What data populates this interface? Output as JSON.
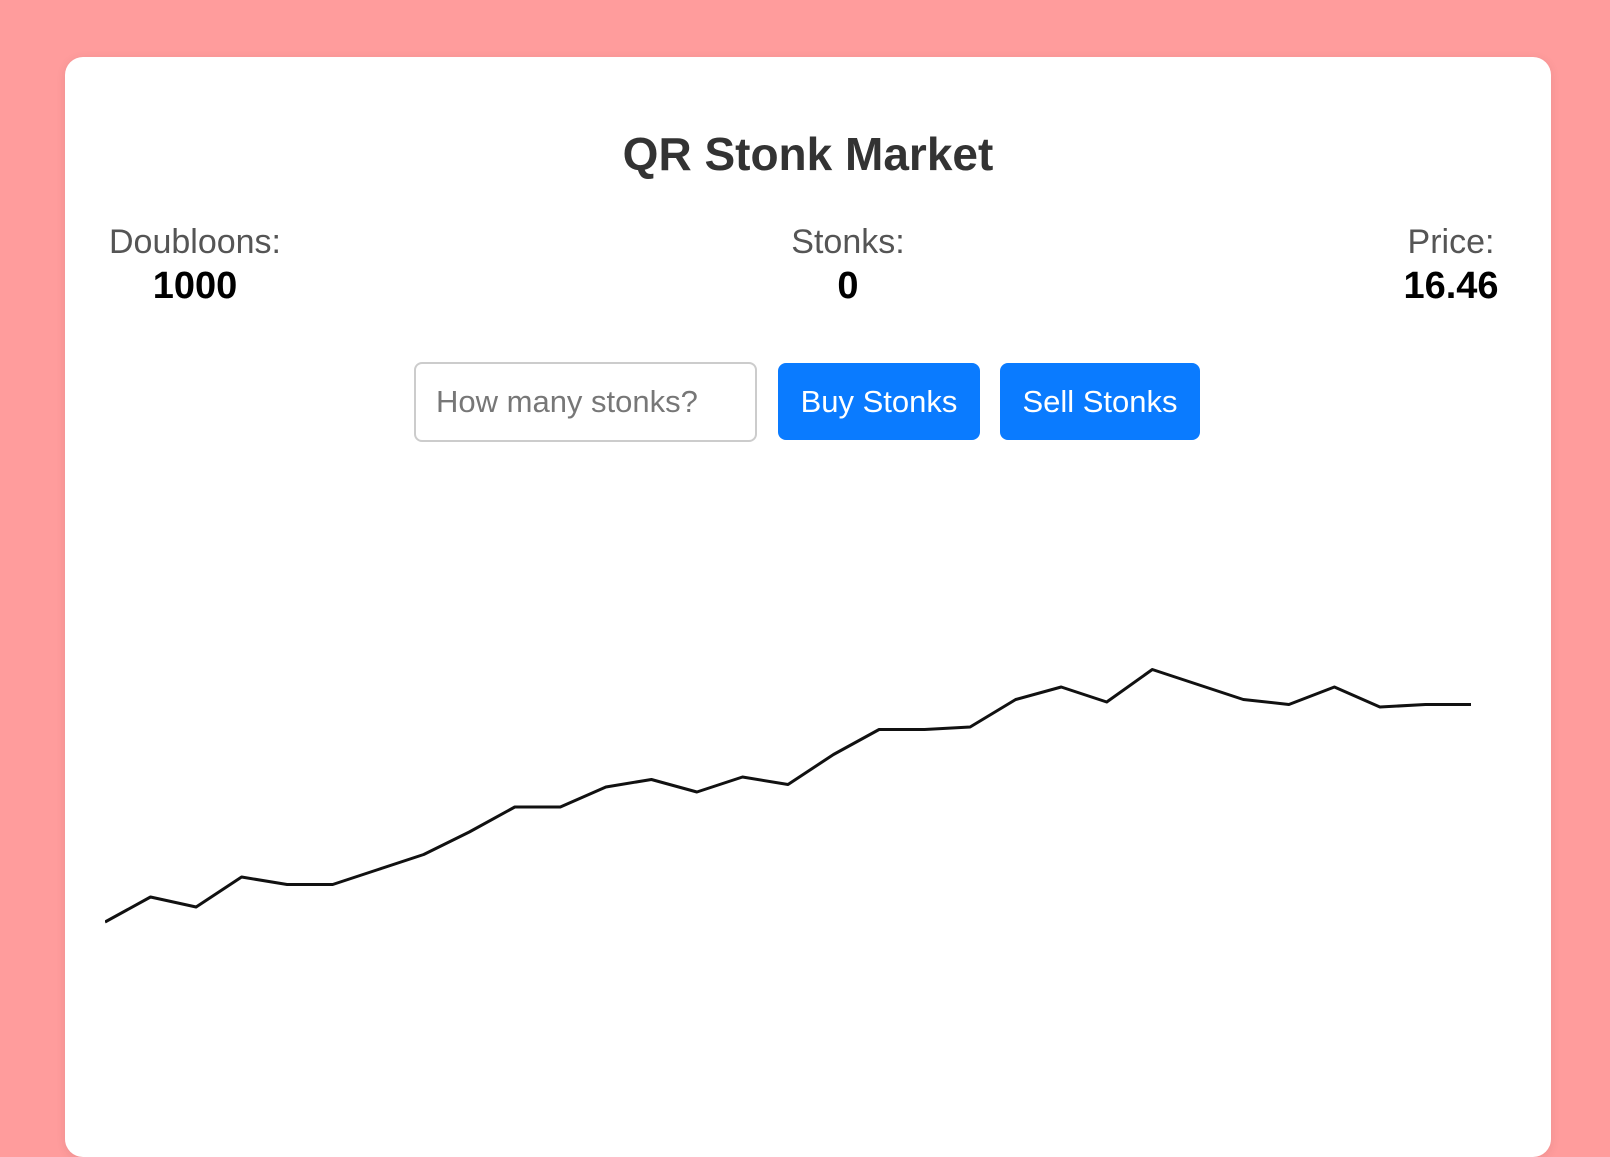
{
  "app": {
    "title": "QR Stonk Market"
  },
  "stats": {
    "doubloons_label": "Doubloons:",
    "doubloons_value": "1000",
    "stonks_label": "Stonks:",
    "stonks_value": "0",
    "price_label": "Price:",
    "price_value": "16.46"
  },
  "trade": {
    "quantity_placeholder": "How many stonks?",
    "quantity_value": "",
    "buy_label": "Buy Stonks",
    "sell_label": "Sell Stonks"
  },
  "colors": {
    "background": "#ff9c9c",
    "card": "#ffffff",
    "button": "#0a7bff",
    "line": "#111111"
  },
  "chart_data": {
    "type": "line",
    "title": "",
    "xlabel": "",
    "ylabel": "",
    "grid": false,
    "legend": "none",
    "ylim": [
      0,
      24
    ],
    "x": [
      0,
      1,
      2,
      3,
      4,
      5,
      6,
      7,
      8,
      9,
      10,
      11,
      12,
      13,
      14,
      15,
      16,
      17,
      18,
      19,
      20,
      21,
      22,
      23,
      24,
      25,
      26,
      27,
      28,
      29,
      30
    ],
    "series": [
      {
        "values": [
          6.2,
          7.2,
          6.8,
          8.0,
          7.7,
          7.7,
          8.3,
          8.9,
          9.8,
          10.8,
          10.8,
          11.6,
          11.9,
          11.4,
          12.0,
          11.7,
          12.9,
          13.9,
          13.9,
          14.0,
          15.1,
          15.6,
          15.0,
          16.3,
          15.7,
          15.1,
          14.9,
          15.6,
          14.8,
          14.9,
          14.9
        ]
      }
    ]
  }
}
